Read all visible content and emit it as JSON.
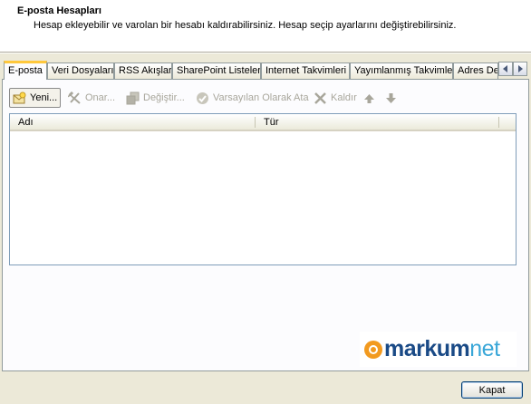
{
  "header": {
    "title": "E-posta Hesapları",
    "subtitle": "Hesap ekleyebilir ve varolan bir hesabı kaldırabilirsiniz. Hesap seçip ayarlarını değiştirebilirsiniz."
  },
  "tabs": [
    {
      "label": "E-posta",
      "active": true
    },
    {
      "label": "Veri Dosyaları"
    },
    {
      "label": "RSS Akışları"
    },
    {
      "label": "SharePoint Listeleri"
    },
    {
      "label": "Internet Takvimleri"
    },
    {
      "label": "Yayımlanmış Takvimler"
    },
    {
      "label": "Adres Defterleri"
    }
  ],
  "toolbar": {
    "new_label": "Yeni...",
    "repair_label": "Onar...",
    "change_label": "Değiştir...",
    "set_default_label": "Varsayılan Olarak Ata",
    "remove_label": "Kaldır"
  },
  "list": {
    "columns": [
      "Adı",
      "Tür"
    ],
    "rows": []
  },
  "watermark": {
    "brand": "markum",
    "suffix": "net"
  },
  "footer": {
    "close_label": "Kapat"
  },
  "colors": {
    "active_tab_accent": "#ffc83c",
    "brand_dark": "#1a4a86",
    "brand_light": "#3aa7d8"
  }
}
